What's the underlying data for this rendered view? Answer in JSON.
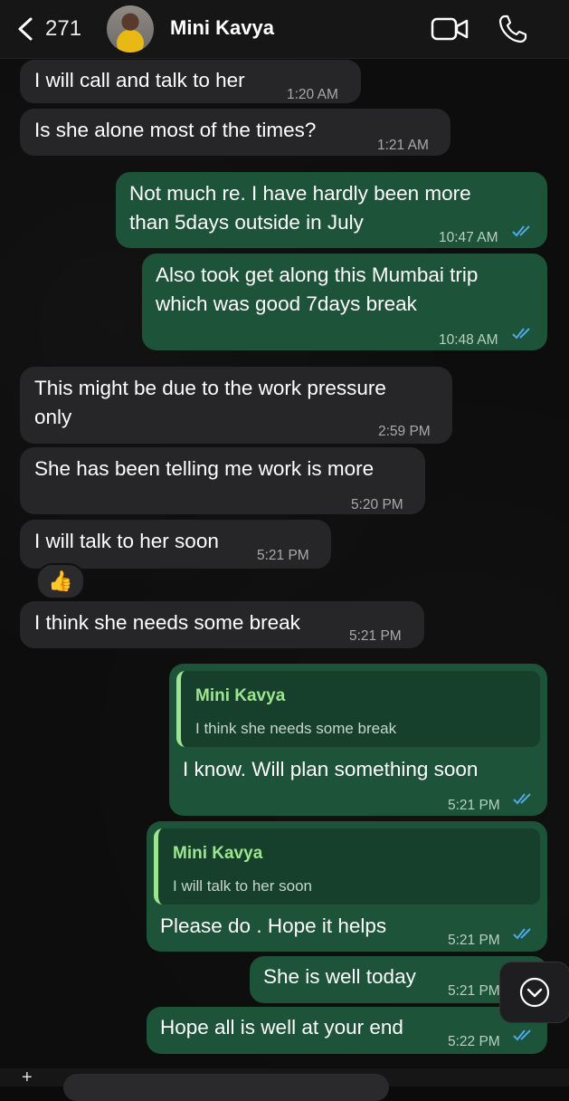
{
  "header": {
    "unread_count": "271",
    "contact_name": "Mini Kavya"
  },
  "messages": [
    {
      "direction": "in",
      "text": "I will call and talk to her",
      "time": "1:20 AM"
    },
    {
      "direction": "in",
      "text": "Is she alone most of the times?",
      "time": "1:21 AM"
    },
    {
      "direction": "out",
      "text": "Not much re. I have hardly been more\nthan 5days outside in July",
      "time": "10:47 AM",
      "status": "read"
    },
    {
      "direction": "out",
      "text": "Also took get along this Mumbai trip\nwhich was good 7days break",
      "time": "10:48 AM",
      "status": "read"
    },
    {
      "direction": "in",
      "text": "This might be due to the work pressure\nonly",
      "time": "2:59 PM"
    },
    {
      "direction": "in",
      "text": "She has been telling me work is more",
      "time": "5:20 PM"
    },
    {
      "direction": "in",
      "text": "I will talk to her soon",
      "time": "5:21 PM",
      "reaction": "👍"
    },
    {
      "direction": "in",
      "text": "I think she needs some break",
      "time": "5:21 PM"
    },
    {
      "direction": "out",
      "quote": {
        "author": "Mini Kavya",
        "text": "I think she needs some break"
      },
      "text": "I know. Will plan something soon",
      "time": "5:21 PM",
      "status": "read"
    },
    {
      "direction": "out",
      "quote": {
        "author": "Mini Kavya",
        "text": "I will talk to her soon"
      },
      "text": "Please do . Hope it helps",
      "time": "5:21 PM",
      "status": "read"
    },
    {
      "direction": "out",
      "text": "She is well today",
      "time": "5:21 PM",
      "status": "read"
    },
    {
      "direction": "out",
      "text": "Hope all is well at your end",
      "time": "5:22 PM",
      "status": "read"
    }
  ],
  "colors": {
    "incoming_bubble": "#262628",
    "outgoing_bubble": "#1c5339",
    "quote_accent": "#9ee58f",
    "read_ticks": "#4fa8e8"
  },
  "icons": [
    "chevron-left-icon",
    "video-camera-icon",
    "phone-icon",
    "double-check-icon",
    "chevron-down-icon",
    "plus-icon"
  ]
}
